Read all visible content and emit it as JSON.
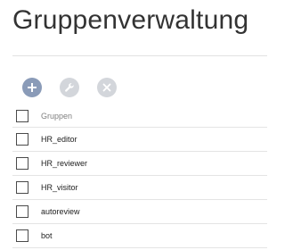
{
  "page": {
    "title": "Gruppenverwaltung"
  },
  "toolbar": {
    "buttons": [
      {
        "name": "add",
        "icon": "plus-icon",
        "color": "#8a9bb8"
      },
      {
        "name": "edit",
        "icon": "wrench-icon",
        "color": "#d3d6db"
      },
      {
        "name": "remove",
        "icon": "close-icon",
        "color": "#d3d6db"
      }
    ]
  },
  "table": {
    "header": "Gruppen",
    "rows": [
      {
        "name": "HR_editor"
      },
      {
        "name": "HR_reviewer"
      },
      {
        "name": "HR_visitor"
      },
      {
        "name": "autoreview"
      },
      {
        "name": "bot"
      }
    ]
  }
}
